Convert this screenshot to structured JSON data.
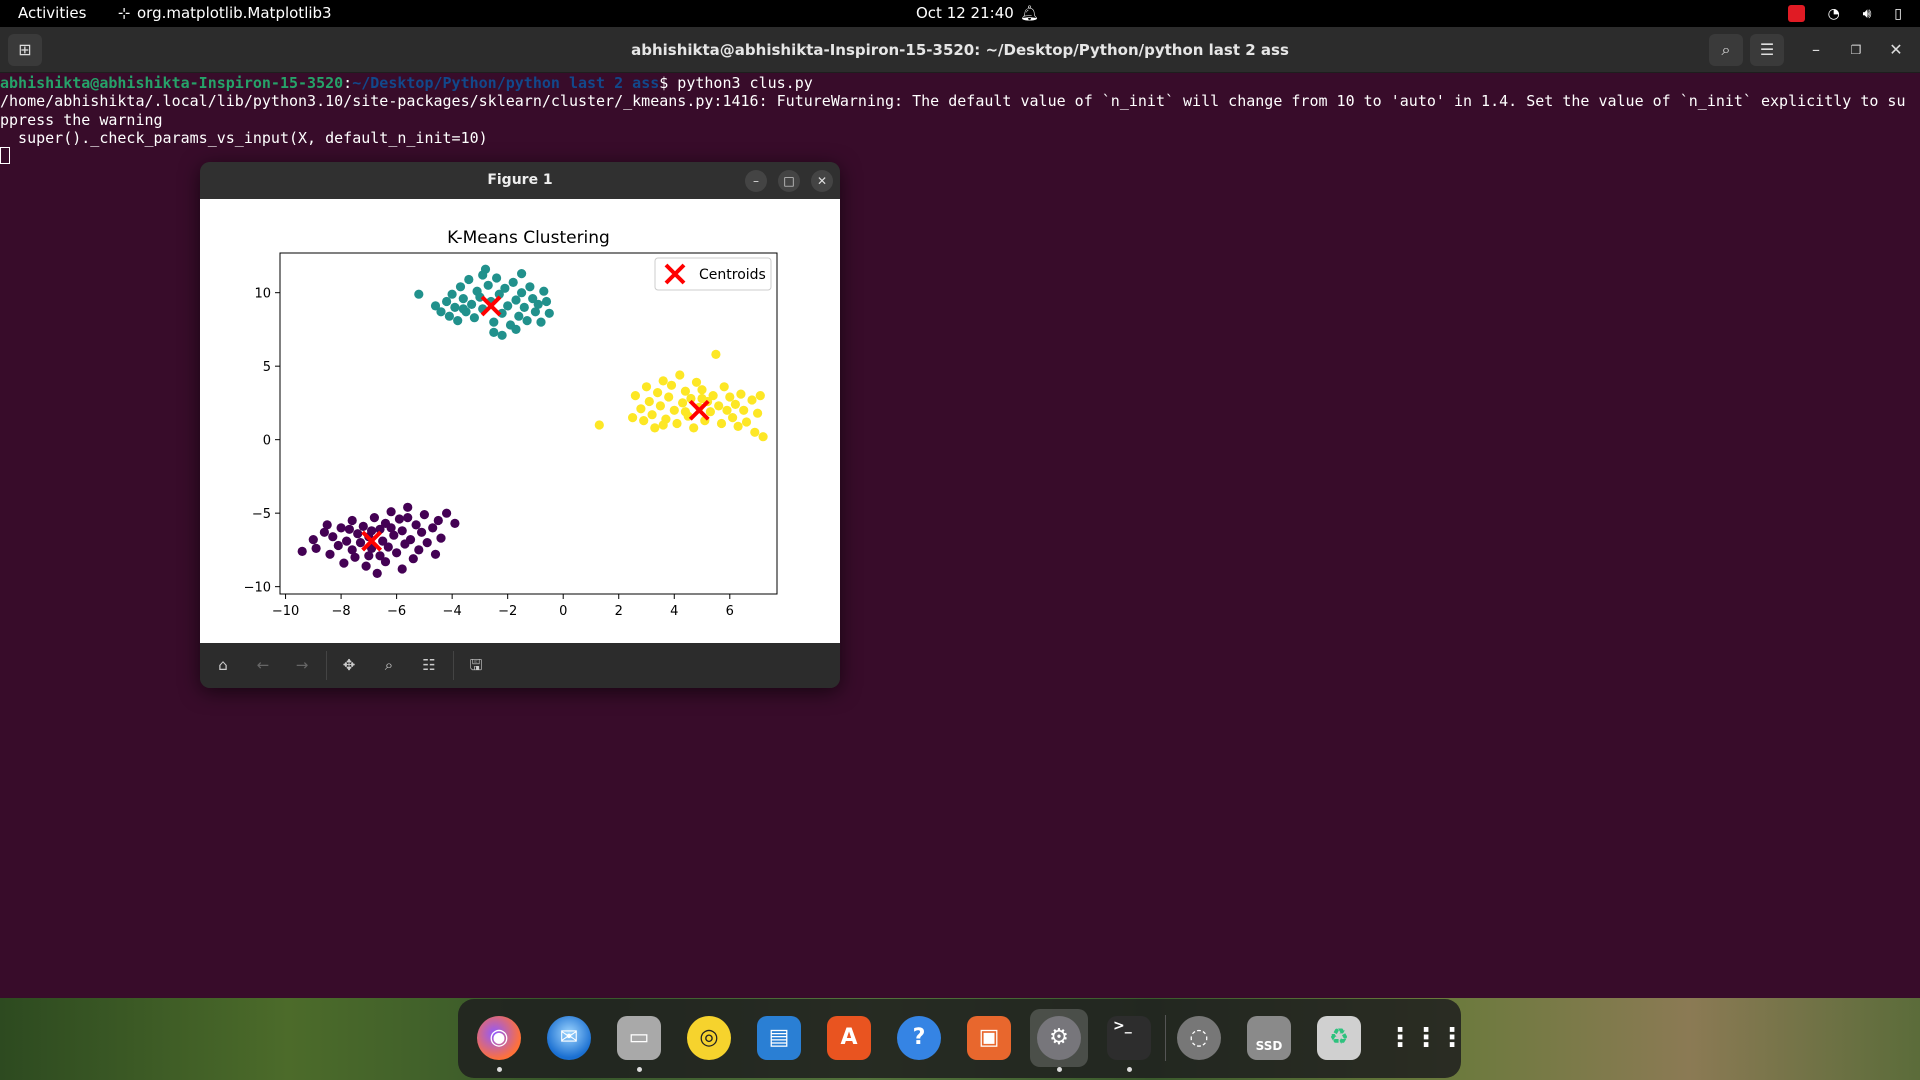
{
  "topbar": {
    "activities": "Activities",
    "app_name": "org.matplotlib.Matplotlib3",
    "clock": "Oct 12  21:40"
  },
  "terminal": {
    "title": "abhishikta@abhishikta-Inspiron-15-3520: ~/Desktop/Python/python last 2 ass",
    "prompt_user": "abhishikta@abhishikta-Inspiron-15-3520",
    "prompt_sep": ":",
    "prompt_path": "~/Desktop/Python/python last 2 ass",
    "prompt_cmd": "$ python3 clus.py",
    "output_line1": "/home/abhishikta/.local/lib/python3.10/site-packages/sklearn/cluster/_kmeans.py:1416: FutureWarning: The default value of `n_init` will change from 10 to 'auto' in 1.4. Set the value of `n_init` explicitly to su",
    "output_line2": "ppress the warning",
    "output_line3": "  super()._check_params_vs_input(X, default_n_init=10)"
  },
  "figure": {
    "window_title": "Figure 1"
  },
  "dock": {
    "apps": [
      "firefox",
      "thunderbird",
      "files",
      "rhythmbox",
      "libreoffice-writer",
      "app-center",
      "help",
      "libreoffice-impress",
      "settings",
      "terminal",
      "disk-usage",
      "ssd-drive",
      "trash",
      "show-apps"
    ]
  },
  "chart_data": {
    "type": "scatter",
    "title": "K-Means Clustering",
    "xlabel": "",
    "ylabel": "",
    "xlim": [
      -10.2,
      7.7
    ],
    "ylim": [
      -10.5,
      12.7
    ],
    "xticks": [
      -10,
      -8,
      -6,
      -4,
      -2,
      0,
      2,
      4,
      6
    ],
    "yticks": [
      -10,
      -5,
      0,
      5,
      10
    ],
    "grid": false,
    "legend": {
      "entries": [
        "Centroids"
      ],
      "position": "top-right"
    },
    "series": [
      {
        "color": "#440154",
        "points": [
          [
            -9.4,
            -7.6
          ],
          [
            -9.0,
            -6.8
          ],
          [
            -8.9,
            -7.4
          ],
          [
            -8.6,
            -6.3
          ],
          [
            -8.5,
            -5.8
          ],
          [
            -8.4,
            -7.8
          ],
          [
            -8.3,
            -6.6
          ],
          [
            -8.1,
            -7.2
          ],
          [
            -8.0,
            -6.0
          ],
          [
            -7.9,
            -8.4
          ],
          [
            -7.8,
            -6.9
          ],
          [
            -7.6,
            -5.5
          ],
          [
            -7.6,
            -7.5
          ],
          [
            -7.5,
            -8.0
          ],
          [
            -7.4,
            -6.4
          ],
          [
            -7.3,
            -7.0
          ],
          [
            -7.2,
            -5.9
          ],
          [
            -7.1,
            -8.6
          ],
          [
            -7.0,
            -6.6
          ],
          [
            -6.9,
            -7.4
          ],
          [
            -6.8,
            -5.3
          ],
          [
            -6.7,
            -9.1
          ],
          [
            -6.6,
            -6.1
          ],
          [
            -6.6,
            -7.9
          ],
          [
            -6.5,
            -6.9
          ],
          [
            -6.4,
            -5.7
          ],
          [
            -6.4,
            -8.3
          ],
          [
            -6.3,
            -7.3
          ],
          [
            -6.2,
            -4.9
          ],
          [
            -6.1,
            -6.5
          ],
          [
            -6.0,
            -7.7
          ],
          [
            -5.9,
            -5.4
          ],
          [
            -5.8,
            -8.8
          ],
          [
            -5.8,
            -6.2
          ],
          [
            -5.7,
            -7.1
          ],
          [
            -5.6,
            -4.6
          ],
          [
            -5.5,
            -6.8
          ],
          [
            -5.4,
            -8.1
          ],
          [
            -5.3,
            -5.8
          ],
          [
            -5.2,
            -7.5
          ],
          [
            -5.1,
            -6.3
          ],
          [
            -5.0,
            -5.1
          ],
          [
            -4.9,
            -7.0
          ],
          [
            -4.7,
            -6.0
          ],
          [
            -4.6,
            -7.8
          ],
          [
            -4.5,
            -5.5
          ],
          [
            -4.4,
            -6.7
          ],
          [
            -4.2,
            -5.0
          ],
          [
            -3.9,
            -5.7
          ],
          [
            -6.9,
            -6.2
          ],
          [
            -7.7,
            -6.1
          ],
          [
            -6.2,
            -6.0
          ],
          [
            -5.6,
            -5.3
          ],
          [
            -7.0,
            -7.9
          ]
        ]
      },
      {
        "color": "#21918c",
        "points": [
          [
            -5.2,
            9.9
          ],
          [
            -4.6,
            9.1
          ],
          [
            -4.4,
            8.7
          ],
          [
            -4.2,
            9.4
          ],
          [
            -4.1,
            8.4
          ],
          [
            -4.0,
            9.9
          ],
          [
            -3.9,
            9.0
          ],
          [
            -3.8,
            8.1
          ],
          [
            -3.7,
            10.4
          ],
          [
            -3.6,
            9.6
          ],
          [
            -3.5,
            8.7
          ],
          [
            -3.4,
            10.9
          ],
          [
            -3.3,
            9.2
          ],
          [
            -3.2,
            8.3
          ],
          [
            -3.1,
            10.1
          ],
          [
            -3.0,
            9.7
          ],
          [
            -2.9,
            8.9
          ],
          [
            -2.8,
            11.6
          ],
          [
            -2.7,
            10.5
          ],
          [
            -2.6,
            9.4
          ],
          [
            -2.5,
            8.0
          ],
          [
            -2.4,
            11.0
          ],
          [
            -2.3,
            9.9
          ],
          [
            -2.2,
            8.6
          ],
          [
            -2.1,
            10.3
          ],
          [
            -2.0,
            9.1
          ],
          [
            -1.9,
            7.8
          ],
          [
            -1.8,
            10.7
          ],
          [
            -1.7,
            9.5
          ],
          [
            -1.6,
            8.4
          ],
          [
            -1.5,
            10.0
          ],
          [
            -1.4,
            9.0
          ],
          [
            -1.3,
            8.1
          ],
          [
            -1.2,
            10.4
          ],
          [
            -1.1,
            9.6
          ],
          [
            -1.0,
            8.7
          ],
          [
            -0.9,
            9.2
          ],
          [
            -0.8,
            8.0
          ],
          [
            -0.7,
            10.1
          ],
          [
            -0.6,
            9.4
          ],
          [
            -0.5,
            8.6
          ],
          [
            -2.5,
            7.3
          ],
          [
            -2.9,
            11.2
          ],
          [
            -1.5,
            11.3
          ],
          [
            -3.6,
            8.9
          ],
          [
            -1.7,
            7.5
          ],
          [
            -2.2,
            7.1
          ]
        ]
      },
      {
        "color": "#fde725",
        "points": [
          [
            1.3,
            1.0
          ],
          [
            2.5,
            1.5
          ],
          [
            2.6,
            3.0
          ],
          [
            2.8,
            2.1
          ],
          [
            2.9,
            1.3
          ],
          [
            3.0,
            3.6
          ],
          [
            3.1,
            2.6
          ],
          [
            3.2,
            1.7
          ],
          [
            3.3,
            0.8
          ],
          [
            3.4,
            3.2
          ],
          [
            3.5,
            2.3
          ],
          [
            3.6,
            4.0
          ],
          [
            3.7,
            1.4
          ],
          [
            3.8,
            2.9
          ],
          [
            3.9,
            3.7
          ],
          [
            4.0,
            2.0
          ],
          [
            4.1,
            1.1
          ],
          [
            4.2,
            4.4
          ],
          [
            4.3,
            2.5
          ],
          [
            4.4,
            3.3
          ],
          [
            4.5,
            1.6
          ],
          [
            4.6,
            2.8
          ],
          [
            4.7,
            0.8
          ],
          [
            4.8,
            3.9
          ],
          [
            4.9,
            2.2
          ],
          [
            5.0,
            3.4
          ],
          [
            5.1,
            1.3
          ],
          [
            5.2,
            2.6
          ],
          [
            5.3,
            1.9
          ],
          [
            5.4,
            3.0
          ],
          [
            5.5,
            5.8
          ],
          [
            5.6,
            2.3
          ],
          [
            5.7,
            1.1
          ],
          [
            5.8,
            3.6
          ],
          [
            5.9,
            2.0
          ],
          [
            6.0,
            2.9
          ],
          [
            6.1,
            1.5
          ],
          [
            6.2,
            2.4
          ],
          [
            6.3,
            0.9
          ],
          [
            6.4,
            3.1
          ],
          [
            6.5,
            2.0
          ],
          [
            6.6,
            1.2
          ],
          [
            6.8,
            2.7
          ],
          [
            6.9,
            0.5
          ],
          [
            7.0,
            1.8
          ],
          [
            7.1,
            3.0
          ],
          [
            7.2,
            0.2
          ],
          [
            4.4,
            1.9
          ],
          [
            5.0,
            2.8
          ],
          [
            3.6,
            1.0
          ]
        ]
      }
    ],
    "centroids": {
      "name": "Centroids",
      "color": "#ff0000",
      "points": [
        [
          -6.9,
          -6.9
        ],
        [
          -2.6,
          9.1
        ],
        [
          4.9,
          2.0
        ]
      ]
    }
  }
}
